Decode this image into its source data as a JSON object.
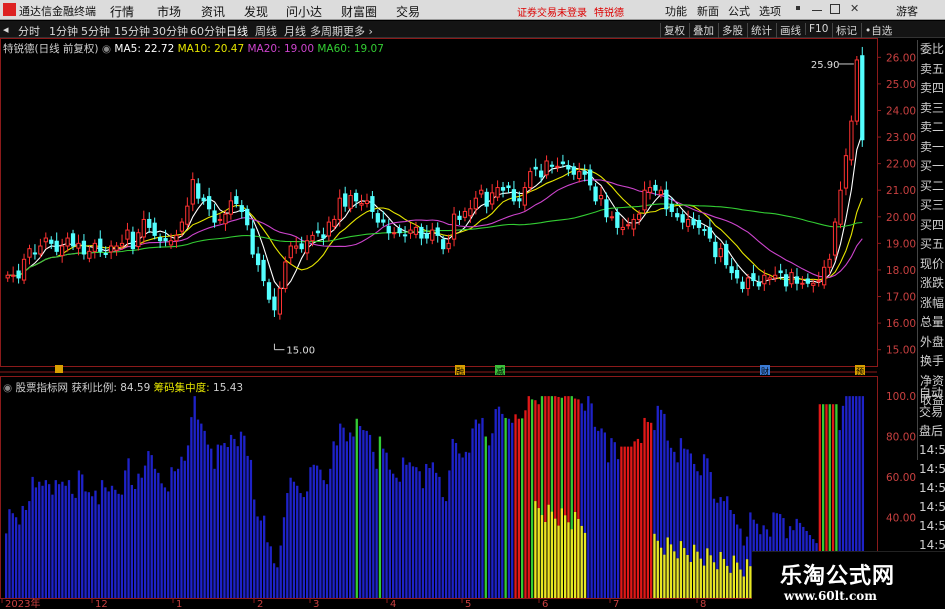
{
  "menubar": {
    "app_title": "通达信金融终端",
    "items": [
      "行情",
      "市场",
      "资讯",
      "发现",
      "问小达",
      "财富圈",
      "交易"
    ],
    "login_text": "证券交易未登录",
    "stock_name": "特锐德",
    "right_items": [
      "功能",
      "新面",
      "公式",
      "选项"
    ],
    "guest": "游客"
  },
  "tabbar": {
    "left_arrow": "◂",
    "periods": [
      "分时",
      "1分钟",
      "5分钟",
      "15分钟",
      "30分钟",
      "60分钟",
      "日线",
      "周线",
      "月线",
      "多周期",
      "更多 ›"
    ],
    "active_period": "日线",
    "right_buttons": [
      "复权",
      "叠加",
      "多股",
      "统计",
      "画线",
      "F10",
      "标记",
      "•自选"
    ]
  },
  "main_legend": {
    "title": "特锐德(日线 前复权)",
    "ma5_label": "MA5: 22.72",
    "ma10_label": "MA10: 20.47",
    "ma20_label": "MA20: 19.00",
    "ma60_label": "MA60: 19.07",
    "ma5_color": "#ffffff",
    "ma10_color": "#e6e600",
    "ma20_color": "#cc44cc",
    "ma60_color": "#33cc33"
  },
  "sub_legend": {
    "title": "股票指标网",
    "profit_label": "获利比例: 84.59",
    "chip_label": "筹码集中度:",
    "chip_value": "15.43"
  },
  "price_axis": [
    "26.00",
    "25.00",
    "24.00",
    "23.00",
    "22.00",
    "21.00",
    "20.00",
    "19.00",
    "18.00",
    "17.00",
    "16.00",
    "15.00"
  ],
  "sub_axis": [
    "100.0",
    "80.00",
    "60.00",
    "40.00"
  ],
  "x_axis": [
    "2023年",
    "12",
    "1",
    "2",
    "3",
    "4",
    "5",
    "6",
    "7",
    "8"
  ],
  "annotations": {
    "high": "25.90",
    "low": "15.00",
    "markers": [
      "融",
      "减",
      "财",
      "预"
    ]
  },
  "sidebar_top": [
    "委比",
    "卖五",
    "卖四",
    "卖三",
    "卖二",
    "卖一",
    "买一",
    "买二",
    "买三",
    "买四",
    "买五",
    "现价",
    "涨跌",
    "涨幅",
    "总量",
    "外盘",
    "换手",
    "净资",
    "收益"
  ],
  "sidebar_bottom": [
    "自动",
    "交易",
    "盘后",
    "14:5",
    "14:5",
    "14:5",
    "14:5",
    "14:5",
    "14:5",
    "14:5",
    "14:5",
    "14:5"
  ],
  "watermark": {
    "title": "乐淘公式网",
    "url": "www.60lt.com"
  },
  "chart_data": {
    "type": "bar",
    "title": "",
    "price_range": [
      14.8,
      26.2
    ],
    "closes": [
      17.8,
      17.8,
      17.7,
      18.4,
      18.8,
      18.6,
      18.9,
      19.2,
      19.0,
      18.7,
      18.9,
      19.2,
      18.9,
      19.0,
      18.6,
      18.7,
      19.0,
      18.7,
      18.6,
      18.9,
      18.9,
      19.0,
      19.5,
      18.8,
      19.4,
      19.9,
      19.6,
      19.3,
      19.1,
      19.1,
      19.1,
      19.3,
      19.8,
      20.4,
      21.4,
      20.7,
      20.6,
      20.3,
      19.8,
      19.9,
      20.1,
      20.6,
      20.5,
      20.2,
      19.7,
      18.6,
      18.2,
      17.6,
      16.9,
      16.5,
      17.3,
      18.3,
      18.9,
      18.9,
      18.8,
      19.1,
      19.3,
      19.4,
      19.2,
      19.8,
      19.9,
      20.7,
      20.4,
      20.8,
      20.6,
      20.5,
      20.6,
      20.2,
      19.8,
      19.8,
      19.4,
      19.4,
      19.4,
      19.3,
      19.5,
      19.6,
      19.2,
      19.2,
      19.5,
      19.3,
      18.8,
      19.0,
      20.1,
      19.9,
      20.2,
      20.3,
      20.7,
      21.0,
      20.4,
      20.9,
      21.1,
      21.0,
      21.1,
      20.6,
      20.6,
      21.1,
      21.7,
      21.8,
      21.5,
      22.1,
      21.9,
      21.9,
      22.0,
      21.8,
      21.6,
      21.7,
      21.6,
      21.2,
      20.6,
      20.8,
      20.0,
      20.0,
      19.6,
      19.6,
      19.7,
      19.9,
      20.1,
      21.0,
      21.1,
      21.0,
      21.0,
      20.3,
      20.2,
      20.0,
      19.8,
      19.9,
      19.7,
      19.6,
      19.5,
      19.2,
      18.5,
      18.8,
      18.2,
      17.9,
      17.7,
      17.3,
      17.7,
      17.6,
      17.4,
      17.8,
      17.7,
      17.8,
      17.9,
      17.4,
      17.9,
      17.5,
      17.5,
      17.5,
      17.5,
      17.6,
      18.1,
      18.4,
      19.8,
      21.0,
      22.3,
      23.6,
      25.9,
      22.9
    ]
  },
  "indicator_data": {
    "profit_ratio": 84.59,
    "chip_concentration": 15.43
  }
}
